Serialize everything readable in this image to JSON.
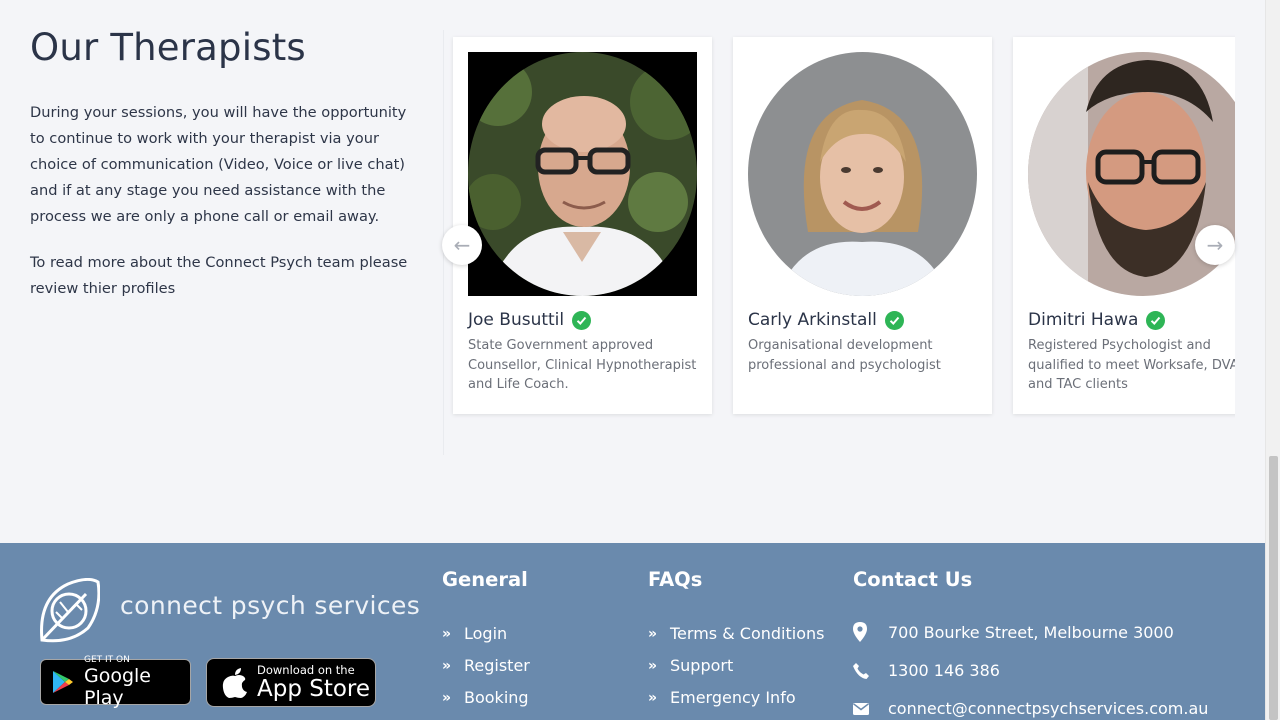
{
  "therapists": {
    "title": "Our Therapists",
    "intro_p1": "During your sessions, you will have the opportunity to continue to work with your therapist via your choice of communication (Video, Voice or live chat) and if at any stage you need assistance with the process we are only a phone call or email away.",
    "intro_p2": "To read more about the Connect Psych team please review thier profiles",
    "cards": [
      {
        "name": "Joe Busuttil",
        "description": "State Government approved Counsellor, Clinical Hypnotherapist and Life Coach."
      },
      {
        "name": "Carly Arkinstall",
        "description": "Organisational development professional and psychologist"
      },
      {
        "name": "Dimitri Hawa",
        "description": "Registered Psychologist and qualified to meet Worksafe, DVA and TAC clients"
      }
    ],
    "prev_arrow": "←",
    "next_arrow": "→"
  },
  "footer": {
    "brand": "connect psych services",
    "google_play": {
      "small": "GET IT ON",
      "big": "Google Play"
    },
    "app_store": {
      "small": "Download on the",
      "big": "App Store"
    },
    "general": {
      "title": "General",
      "links": [
        "Login",
        "Register",
        "Booking"
      ]
    },
    "faqs": {
      "title": "FAQs",
      "links": [
        "Terms & Conditions",
        "Support",
        "Emergency Info"
      ]
    },
    "contact": {
      "title": "Contact Us",
      "address": "700 Bourke Street, Melbourne 3000",
      "phone": "1300 146 386",
      "email": "connect@connectpsychservices.com.au"
    },
    "link_glyph": "»"
  },
  "colors": {
    "footer_bg": "#6a8aad",
    "page_bg": "#f4f5f8",
    "verified_green": "#2eb556"
  },
  "icons": [
    "check-circle-icon",
    "arrow-left-icon",
    "arrow-right-icon",
    "leaf-logo-icon",
    "google-play-icon",
    "apple-icon",
    "double-chevron-icon",
    "map-pin-icon",
    "phone-icon",
    "envelope-icon"
  ]
}
